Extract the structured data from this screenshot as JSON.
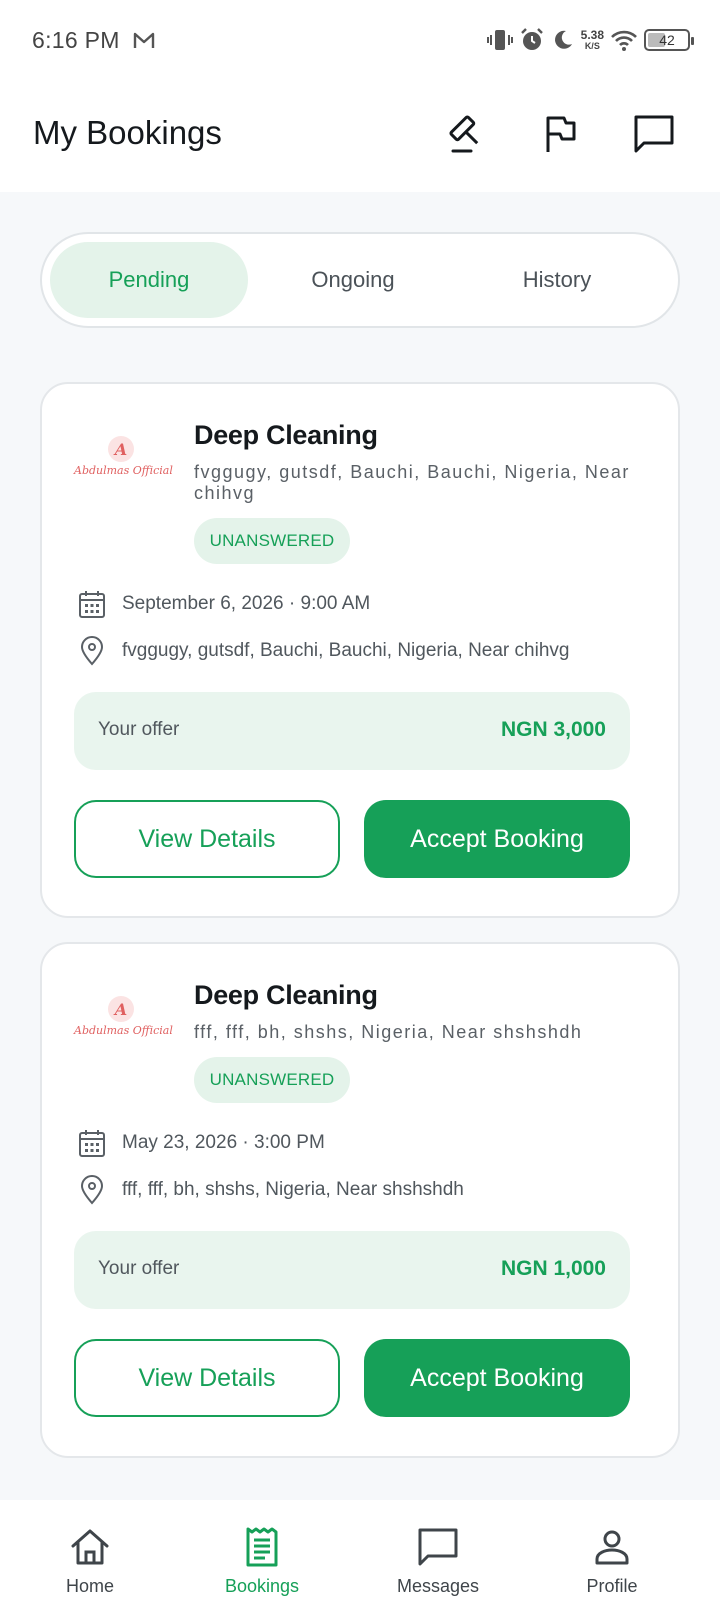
{
  "status_bar": {
    "time": "6:16 PM",
    "mail_icon": "gmail-icon",
    "net_speed": "5.38",
    "net_unit": "K/S",
    "battery": "42"
  },
  "header": {
    "title": "My Bookings",
    "icons": [
      "gavel-icon",
      "flag-icon",
      "chat-icon"
    ]
  },
  "tabs": [
    {
      "label": "Pending",
      "active": true
    },
    {
      "label": "Ongoing",
      "active": false
    },
    {
      "label": "History",
      "active": false
    }
  ],
  "bookings": [
    {
      "logo_letter": "A",
      "logo_text": "Abdulmas Official",
      "title": "Deep Cleaning",
      "address": "fvggugy, gutsdf, Bauchi, Bauchi, Nigeria, Near chihvg",
      "status": "UNANSWERED",
      "datetime": "September 6, 2026 · 9:00 AM",
      "location": "fvggugy, gutsdf, Bauchi, Bauchi, Nigeria, Near chihvg",
      "offer_label": "Your offer",
      "offer_value": "NGN 3,000",
      "view_label": "View Details",
      "accept_label": "Accept Booking"
    },
    {
      "logo_letter": "A",
      "logo_text": "Abdulmas Official",
      "title": "Deep Cleaning",
      "address": "fff, fff, bh, shshs, Nigeria, Near shshshdh",
      "status": "UNANSWERED",
      "datetime": "May 23, 2026 · 3:00 PM",
      "location": "fff, fff, bh, shshs, Nigeria, Near shshshdh",
      "offer_label": "Your offer",
      "offer_value": "NGN 1,000",
      "view_label": "View Details",
      "accept_label": "Accept Booking"
    }
  ],
  "bottom_nav": [
    {
      "label": "Home",
      "icon": "home-icon",
      "active": false
    },
    {
      "label": "Bookings",
      "icon": "receipt-icon",
      "active": true
    },
    {
      "label": "Messages",
      "icon": "message-icon",
      "active": false
    },
    {
      "label": "Profile",
      "icon": "person-icon",
      "active": false
    }
  ],
  "colors": {
    "accent": "#16a058",
    "accent_light": "#e4f3ea",
    "logo": "#e06060"
  }
}
